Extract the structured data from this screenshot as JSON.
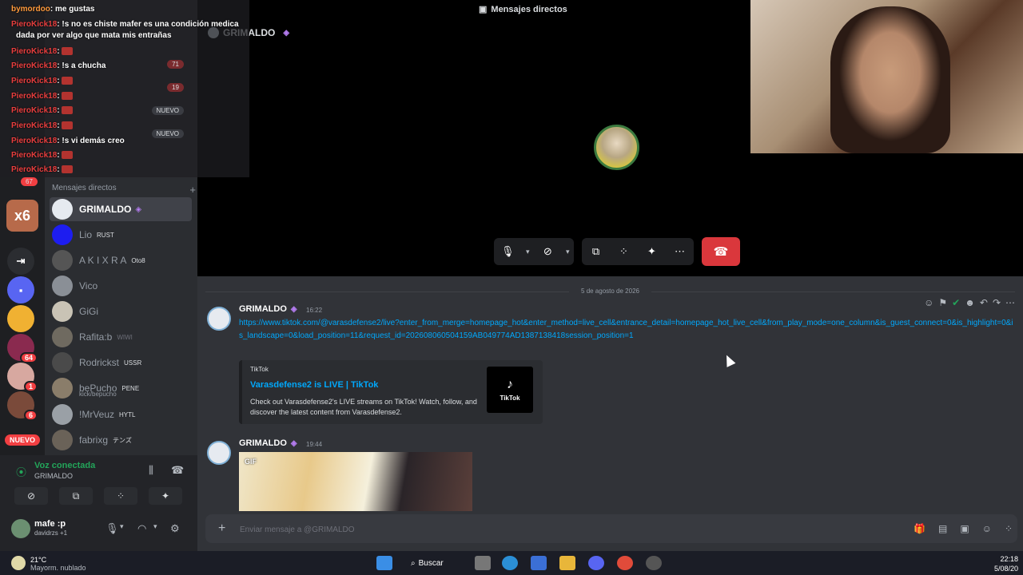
{
  "overlay": {
    "lines": [
      {
        "user": "bymordoo",
        "text": ": me gustas"
      },
      {
        "user": "PieroKick18",
        "text": ": !s no es chiste mafer es una condición medica"
      },
      {
        "user": "",
        "text": "dada por ver algo que mata mis entrañas"
      },
      {
        "user": "PieroKick18",
        "text": ":"
      },
      {
        "user": "PieroKick18",
        "text": ": !s a chucha"
      },
      {
        "user": "PieroKick18",
        "text": ":"
      },
      {
        "user": "PieroKick18",
        "text": ":"
      },
      {
        "user": "PieroKick18",
        "text": ":"
      },
      {
        "user": "PieroKick18",
        "text": ":"
      },
      {
        "user": "PieroKick18",
        "text": ": !s vi demás creo"
      },
      {
        "user": "PieroKick18",
        "text": ":"
      },
      {
        "user": "PieroKick18",
        "text": ":"
      }
    ],
    "pills": [
      "71",
      "19",
      "NUEVO",
      "NUEVO"
    ],
    "multiplier": "x6",
    "rail_badge": "67"
  },
  "rail": {
    "badges": [
      "64",
      "1",
      "6"
    ],
    "nuevo": "NUEVO"
  },
  "sidebar": {
    "dm_header": "Mensajes directos",
    "dm_add": "+",
    "items": [
      {
        "name": "GRIMALDO",
        "tag": "",
        "sub": "",
        "active": true
      },
      {
        "name": "Lio",
        "tag": "RUST",
        "sub": ""
      },
      {
        "name": "A K I X R A",
        "tag": "Oto8",
        "sub": ""
      },
      {
        "name": "Vico",
        "tag": "",
        "sub": ""
      },
      {
        "name": "GiGi",
        "tag": "",
        "sub": ""
      },
      {
        "name": "Rafita:b",
        "tag": "WIWI",
        "sub": ""
      },
      {
        "name": "Rodrickst",
        "tag": "USSR",
        "sub": ""
      },
      {
        "name": "bePucho",
        "tag": "PENE",
        "sub": "kick/bepucho"
      },
      {
        "name": "!MrVeuz",
        "tag": "HYTL",
        "sub": ""
      },
      {
        "name": "fabrixg",
        "tag": "テンズ",
        "sub": ""
      }
    ]
  },
  "voice": {
    "title": "Voz conectada",
    "channel": "GRIMALDO"
  },
  "user": {
    "name": "mafe :p",
    "status": "davidrzs +1"
  },
  "call": {
    "title": "Mensajes directos",
    "user": "GRIMALDO"
  },
  "messages": {
    "date": "5 de agosto de 2026",
    "msg1": {
      "author": "GRIMALDO",
      "time": "16:22",
      "link": "https://www.tiktok.com/@varasdefense2/live?enter_from_merge=homepage_hot&enter_method=live_cell&entrance_detail=homepage_hot_live_cell&from_play_mode=one_column&is_guest_connect=0&is_highlight=0&is_landscape=0&load_position=11&request_id=202608060504159AB049774AD1387138418session_position=1"
    },
    "embed": {
      "provider": "TikTok",
      "title": "Varasdefense2 is LIVE | TikTok",
      "description": "Check out Varasdefense2's LIVE streams on TikTok! Watch, follow, and discover the latest content from Varasdefense2.",
      "thumb_label": "TikTok"
    },
    "msg2": {
      "author": "GRIMALDO",
      "time": "19:44",
      "gif_label": "GIF"
    }
  },
  "composer": {
    "placeholder": "Enviar mensaje a @GRIMALDO"
  },
  "taskbar": {
    "temp": "21°C",
    "weather": "Mayorm. nublado",
    "search": "Buscar",
    "time": "22:18",
    "date": "5/08/20"
  }
}
